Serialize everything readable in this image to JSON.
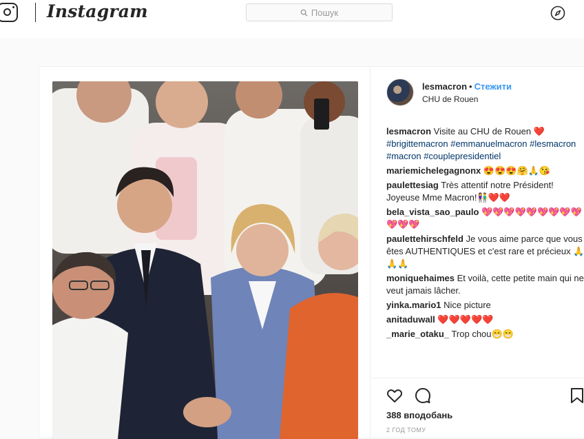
{
  "topbar": {
    "logo": "Instagram",
    "search_placeholder": "Пошук"
  },
  "post": {
    "username": "lesmacron",
    "separator": "•",
    "follow_label": "Стежити",
    "location": "CHU de Rouen",
    "caption": {
      "user": "lesmacron",
      "text": "Visite au CHU de Rouen ❤️",
      "hashtags": "#brigittemacron #emmanuelmacron #lesmacron #macron #couplepresidentiel"
    },
    "comments": [
      {
        "user": "mariemichelegagnonx",
        "text": "😍😍😍🤗🙏😘"
      },
      {
        "user": "paulettesiag",
        "text": "Très attentif notre Président! Joyeuse Mme Macron!👫❤️❤️"
      },
      {
        "user": "bela_vista_sao_paulo",
        "text": "💖💖💖💖💖💖💖💖💖💖💖💖"
      },
      {
        "user": "paulettehirschfeld",
        "text": "Je vous aime parce que vous êtes AUTHENTIQUES et c'est rare et précieux 🙏🙏🙏"
      },
      {
        "user": "moniquehaimes",
        "text": "Et voilà, cette petite main qui ne veut jamais lâcher."
      },
      {
        "user": "yinka.mario1",
        "text": "Nice picture"
      },
      {
        "user": "anitaduwall",
        "text": "❤️❤️❤️❤️❤️"
      },
      {
        "user": "_marie_otaku_",
        "text": "Trop chou😁😁"
      }
    ],
    "likes": "388 вподобань",
    "time_ago": "2 ГОД ТОМУ"
  },
  "icons": {
    "logo": "instagram-camera-icon",
    "search": "search-icon",
    "explore": "compass-icon",
    "like": "heart-icon",
    "comment": "comment-bubble-icon",
    "save": "bookmark-icon"
  },
  "colors": {
    "link_blue": "#3897f0",
    "hashtag": "#003569",
    "heart": "#ed2c4b",
    "text": "#262626",
    "muted": "#999999"
  }
}
